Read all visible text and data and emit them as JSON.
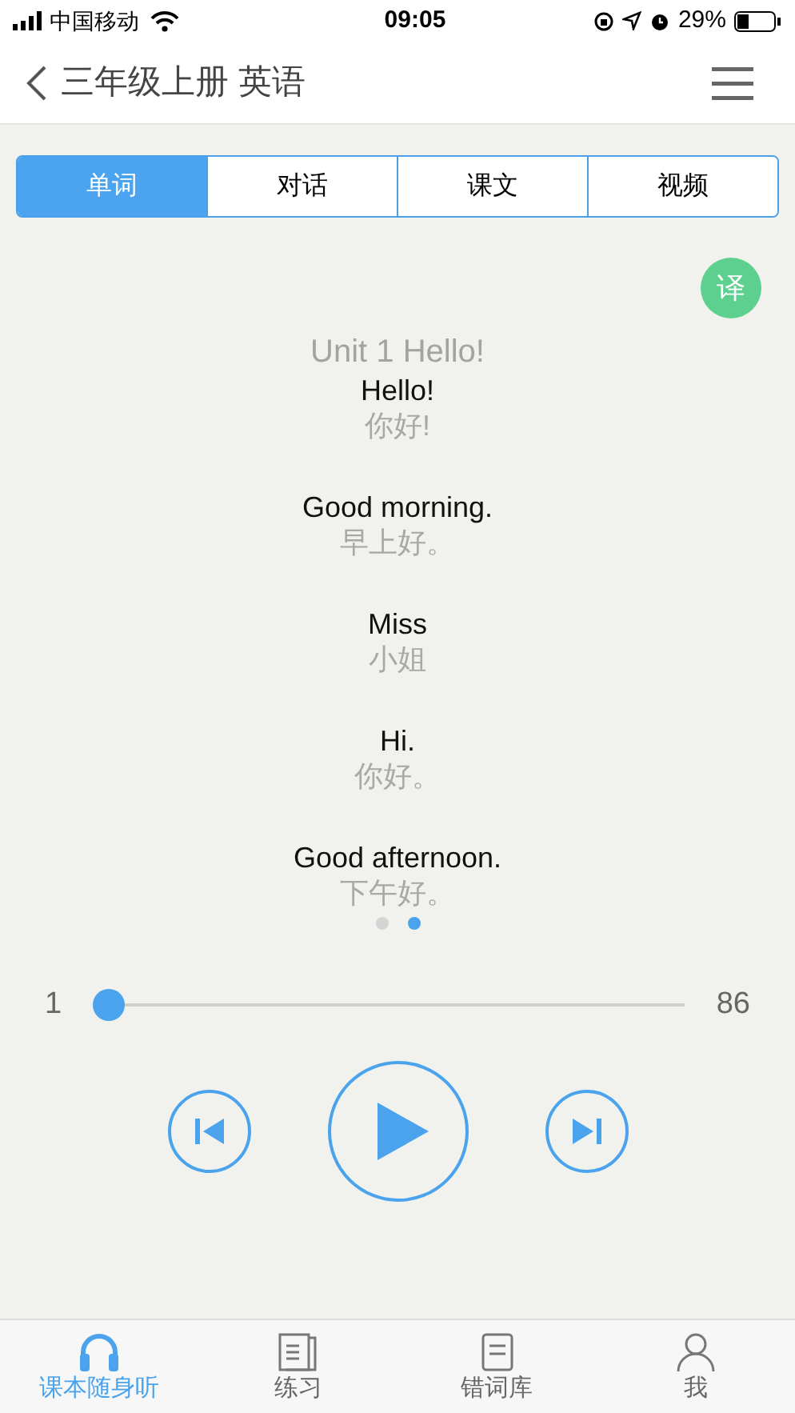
{
  "status_bar": {
    "carrier": "中国移动",
    "time": "09:05",
    "battery": "29%"
  },
  "nav": {
    "title": "三年级上册 英语"
  },
  "tabs": [
    {
      "label": "单词",
      "selected": true
    },
    {
      "label": "对话",
      "selected": false
    },
    {
      "label": "课文",
      "selected": false
    },
    {
      "label": "视频",
      "selected": false
    }
  ],
  "translate_button": "译",
  "lesson": {
    "title": "Unit 1 Hello!",
    "lines": [
      {
        "english": "Hello!",
        "chinese": "你好!"
      },
      {
        "english": "Good morning.",
        "chinese": "早上好。"
      },
      {
        "english": "Miss",
        "chinese": "小姐"
      },
      {
        "english": "Hi.",
        "chinese": "你好。"
      },
      {
        "english": "Good afternoon.",
        "chinese": "下午好。"
      }
    ]
  },
  "pages": [
    {
      "selected": false
    },
    {
      "selected": true
    }
  ],
  "player": {
    "start": "1",
    "end": "86",
    "level": 0.0
  },
  "bottom_tabs": [
    {
      "label": "课本随身听",
      "kind": "headphones",
      "selected": true
    },
    {
      "label": "练习",
      "kind": "book",
      "selected": false
    },
    {
      "label": "错词库",
      "kind": "notebook",
      "selected": false
    },
    {
      "label": "我",
      "kind": "person",
      "selected": false
    }
  ]
}
